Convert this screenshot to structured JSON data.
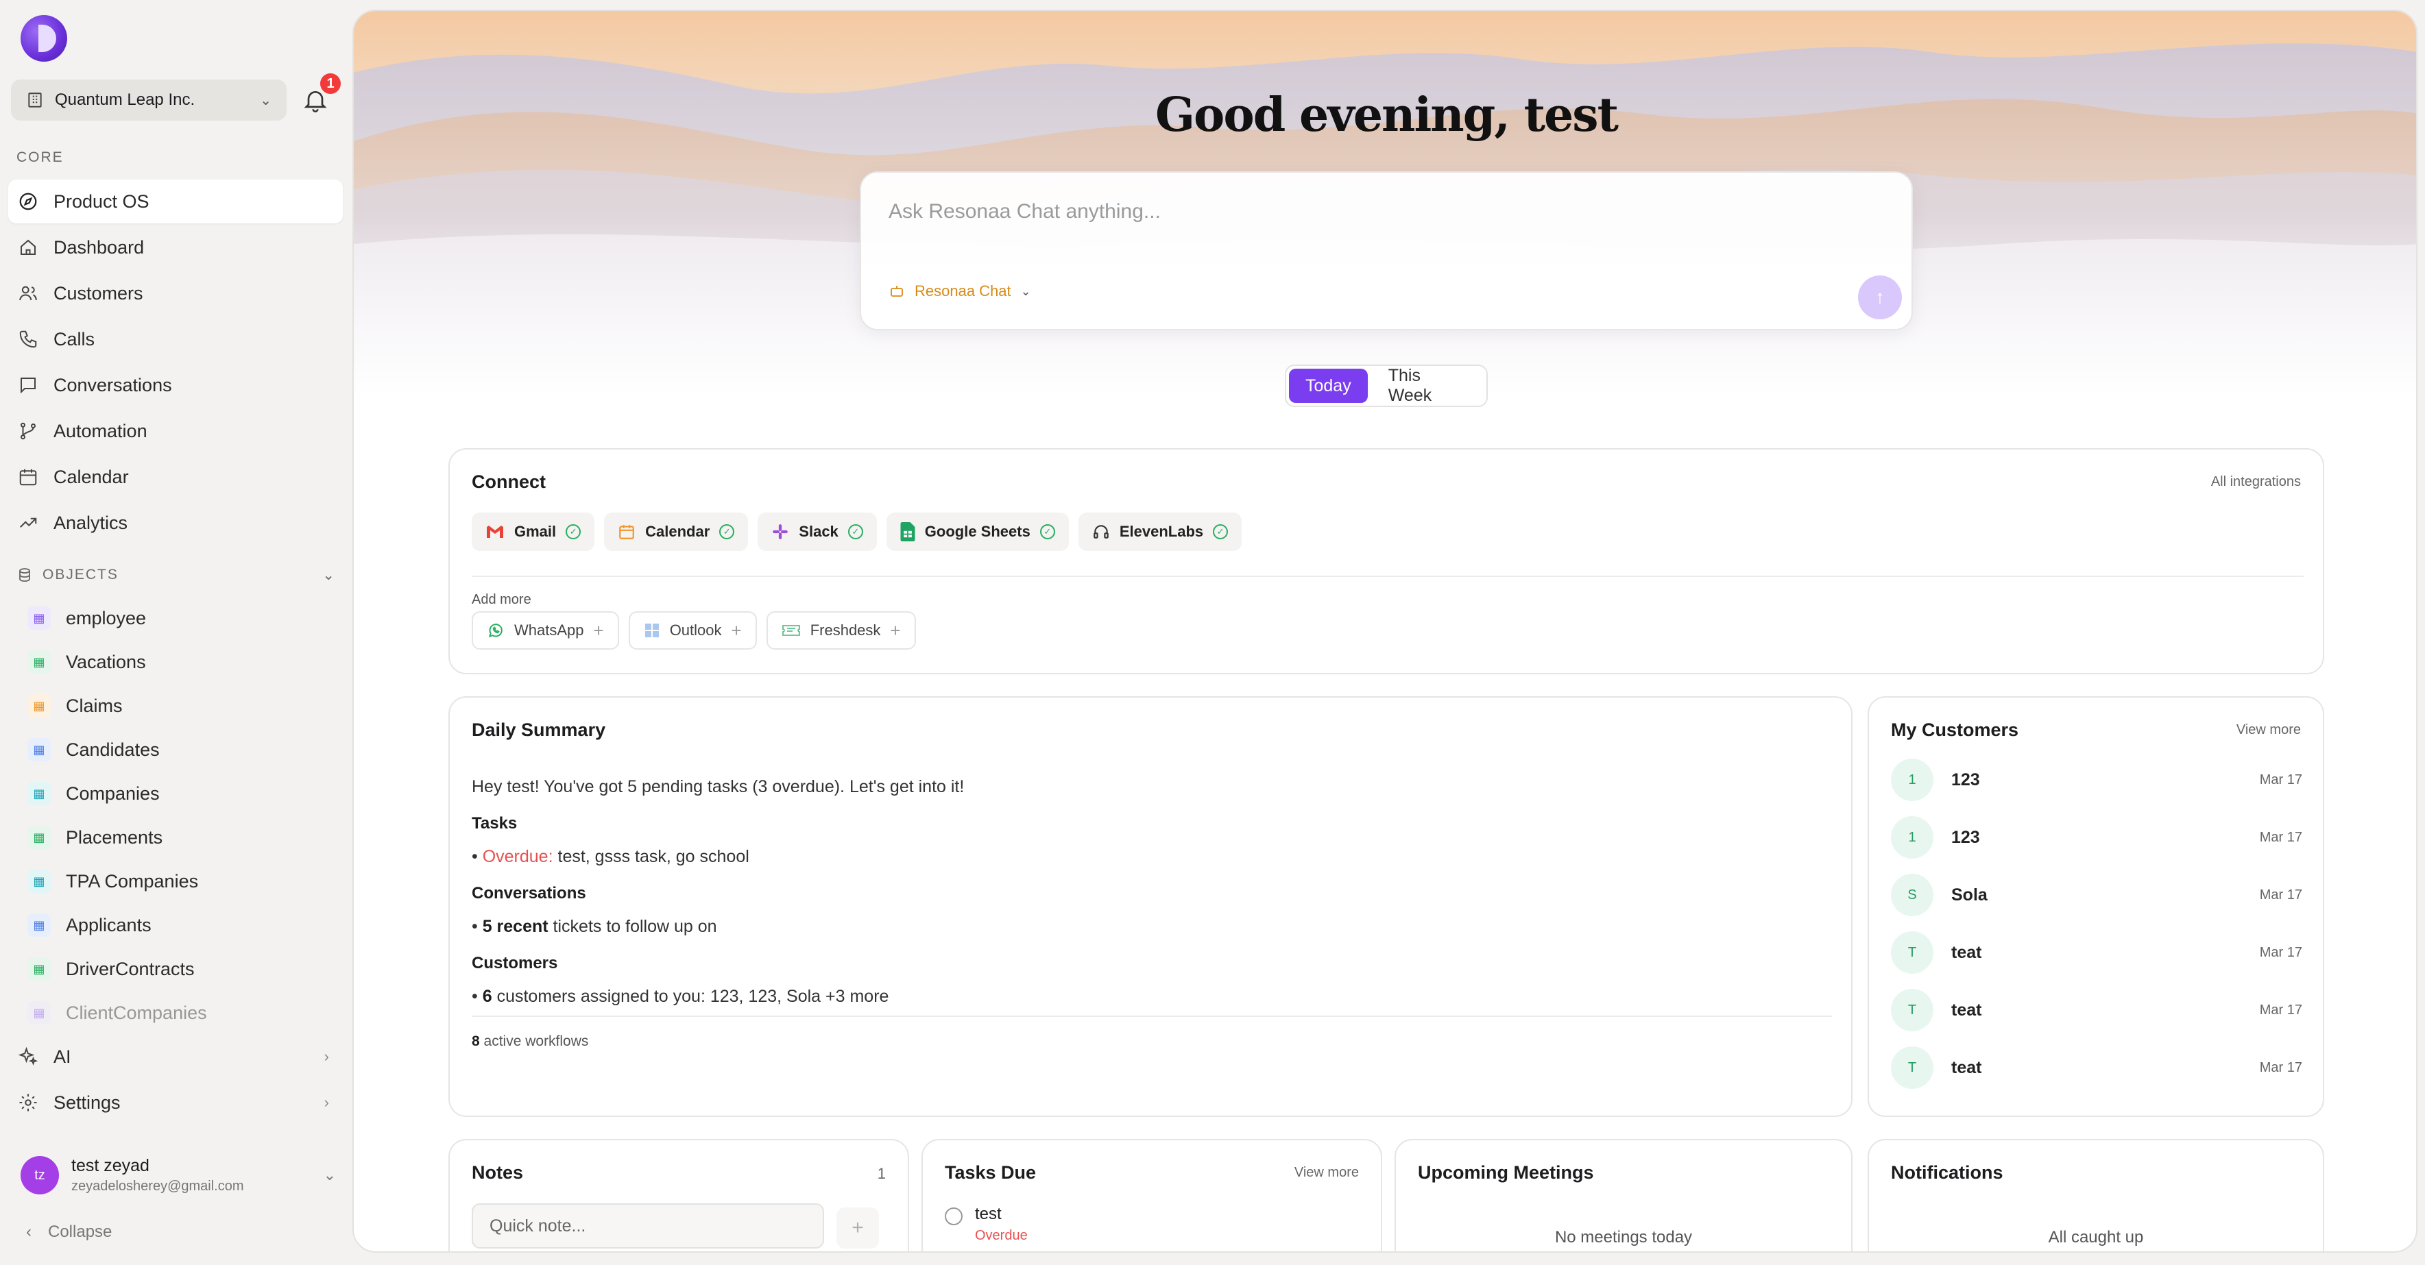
{
  "org": {
    "name": "Quantum Leap Inc."
  },
  "notifications": {
    "count": "1"
  },
  "sidebar": {
    "core_label": "CORE",
    "core_items": [
      {
        "label": "Product OS",
        "icon": "compass-icon"
      },
      {
        "label": "Dashboard",
        "icon": "home-icon"
      },
      {
        "label": "Customers",
        "icon": "users-icon"
      },
      {
        "label": "Calls",
        "icon": "phone-icon"
      },
      {
        "label": "Conversations",
        "icon": "chat-icon"
      },
      {
        "label": "Automation",
        "icon": "branch-icon"
      },
      {
        "label": "Calendar",
        "icon": "calendar-icon"
      },
      {
        "label": "Analytics",
        "icon": "trend-icon"
      }
    ],
    "objects_label": "OBJECTS",
    "objects": [
      {
        "label": "employee",
        "color": "#8a5cf0",
        "bg": "#efe9fd"
      },
      {
        "label": "Vacations",
        "color": "#27ae60",
        "bg": "#e6f6ec"
      },
      {
        "label": "Claims",
        "color": "#f0962a",
        "bg": "#fdf1e2"
      },
      {
        "label": "Candidates",
        "color": "#4a7fe8",
        "bg": "#e7effd"
      },
      {
        "label": "Companies",
        "color": "#1fa5b8",
        "bg": "#e2f5f7"
      },
      {
        "label": "Placements",
        "color": "#27ae60",
        "bg": "#e6f6ec"
      },
      {
        "label": "TPA Companies",
        "color": "#1fa5b8",
        "bg": "#e2f5f7"
      },
      {
        "label": "Applicants",
        "color": "#4a7fe8",
        "bg": "#e7effd"
      },
      {
        "label": "DriverContracts",
        "color": "#27ae60",
        "bg": "#e6f6ec"
      },
      {
        "label": "ClientCompanies",
        "color": "#8a5cf0",
        "bg": "#efe9fd"
      }
    ],
    "ai_label": "AI",
    "settings_label": "Settings",
    "collapse_label": "Collapse"
  },
  "user": {
    "initials": "tz",
    "name": "test zeyad",
    "email": "zeyadelosherey@gmail.com"
  },
  "hero": {
    "greeting": "Good evening, test",
    "chat_placeholder": "Ask Resonaa Chat anything...",
    "model_label": "Resonaa Chat"
  },
  "period": {
    "options": [
      "Today",
      "This Week"
    ],
    "selected": "Today"
  },
  "connect": {
    "title": "Connect",
    "link": "All integrations",
    "connected": [
      {
        "label": "Gmail",
        "icon": "gmail-icon"
      },
      {
        "label": "Calendar",
        "icon": "calendar-icon"
      },
      {
        "label": "Slack",
        "icon": "slack-icon"
      },
      {
        "label": "Google Sheets",
        "icon": "sheets-icon"
      },
      {
        "label": "ElevenLabs",
        "icon": "headphones-icon"
      }
    ],
    "add_more_label": "Add more",
    "available": [
      {
        "label": "WhatsApp",
        "icon": "whatsapp-icon"
      },
      {
        "label": "Outlook",
        "icon": "outlook-icon"
      },
      {
        "label": "Freshdesk",
        "icon": "ticket-icon"
      }
    ]
  },
  "summary": {
    "title": "Daily Summary",
    "intro": "Hey test! You've got 5 pending tasks (3 overdue). Let's get into it!",
    "tasks_head": "Tasks",
    "tasks_overdue_label": "Overdue:",
    "tasks_overdue_items": "test, gsss task, go school",
    "conversations_head": "Conversations",
    "conversations_count": "5 recent",
    "conversations_text": "tickets to follow up on",
    "customers_head": "Customers",
    "customers_count": "6",
    "customers_text": "customers assigned to you: 123, 123, Sola +3 more",
    "workflows_count": "8",
    "workflows_text": "active workflows"
  },
  "my_customers": {
    "title": "My Customers",
    "link": "View more",
    "rows": [
      {
        "initial": "1",
        "name": "123",
        "date": "Mar 17"
      },
      {
        "initial": "1",
        "name": "123",
        "date": "Mar 17"
      },
      {
        "initial": "S",
        "name": "Sola",
        "date": "Mar 17"
      },
      {
        "initial": "T",
        "name": "teat",
        "date": "Mar 17"
      },
      {
        "initial": "T",
        "name": "teat",
        "date": "Mar 17"
      },
      {
        "initial": "T",
        "name": "teat",
        "date": "Mar 17"
      }
    ]
  },
  "notes": {
    "title": "Notes",
    "count": "1",
    "placeholder": "Quick note..."
  },
  "tasks_due": {
    "title": "Tasks Due",
    "link": "View more",
    "task": "test",
    "status": "Overdue"
  },
  "meetings": {
    "title": "Upcoming Meetings",
    "empty": "No meetings today"
  },
  "notifications_card": {
    "title": "Notifications",
    "empty": "All caught up"
  }
}
